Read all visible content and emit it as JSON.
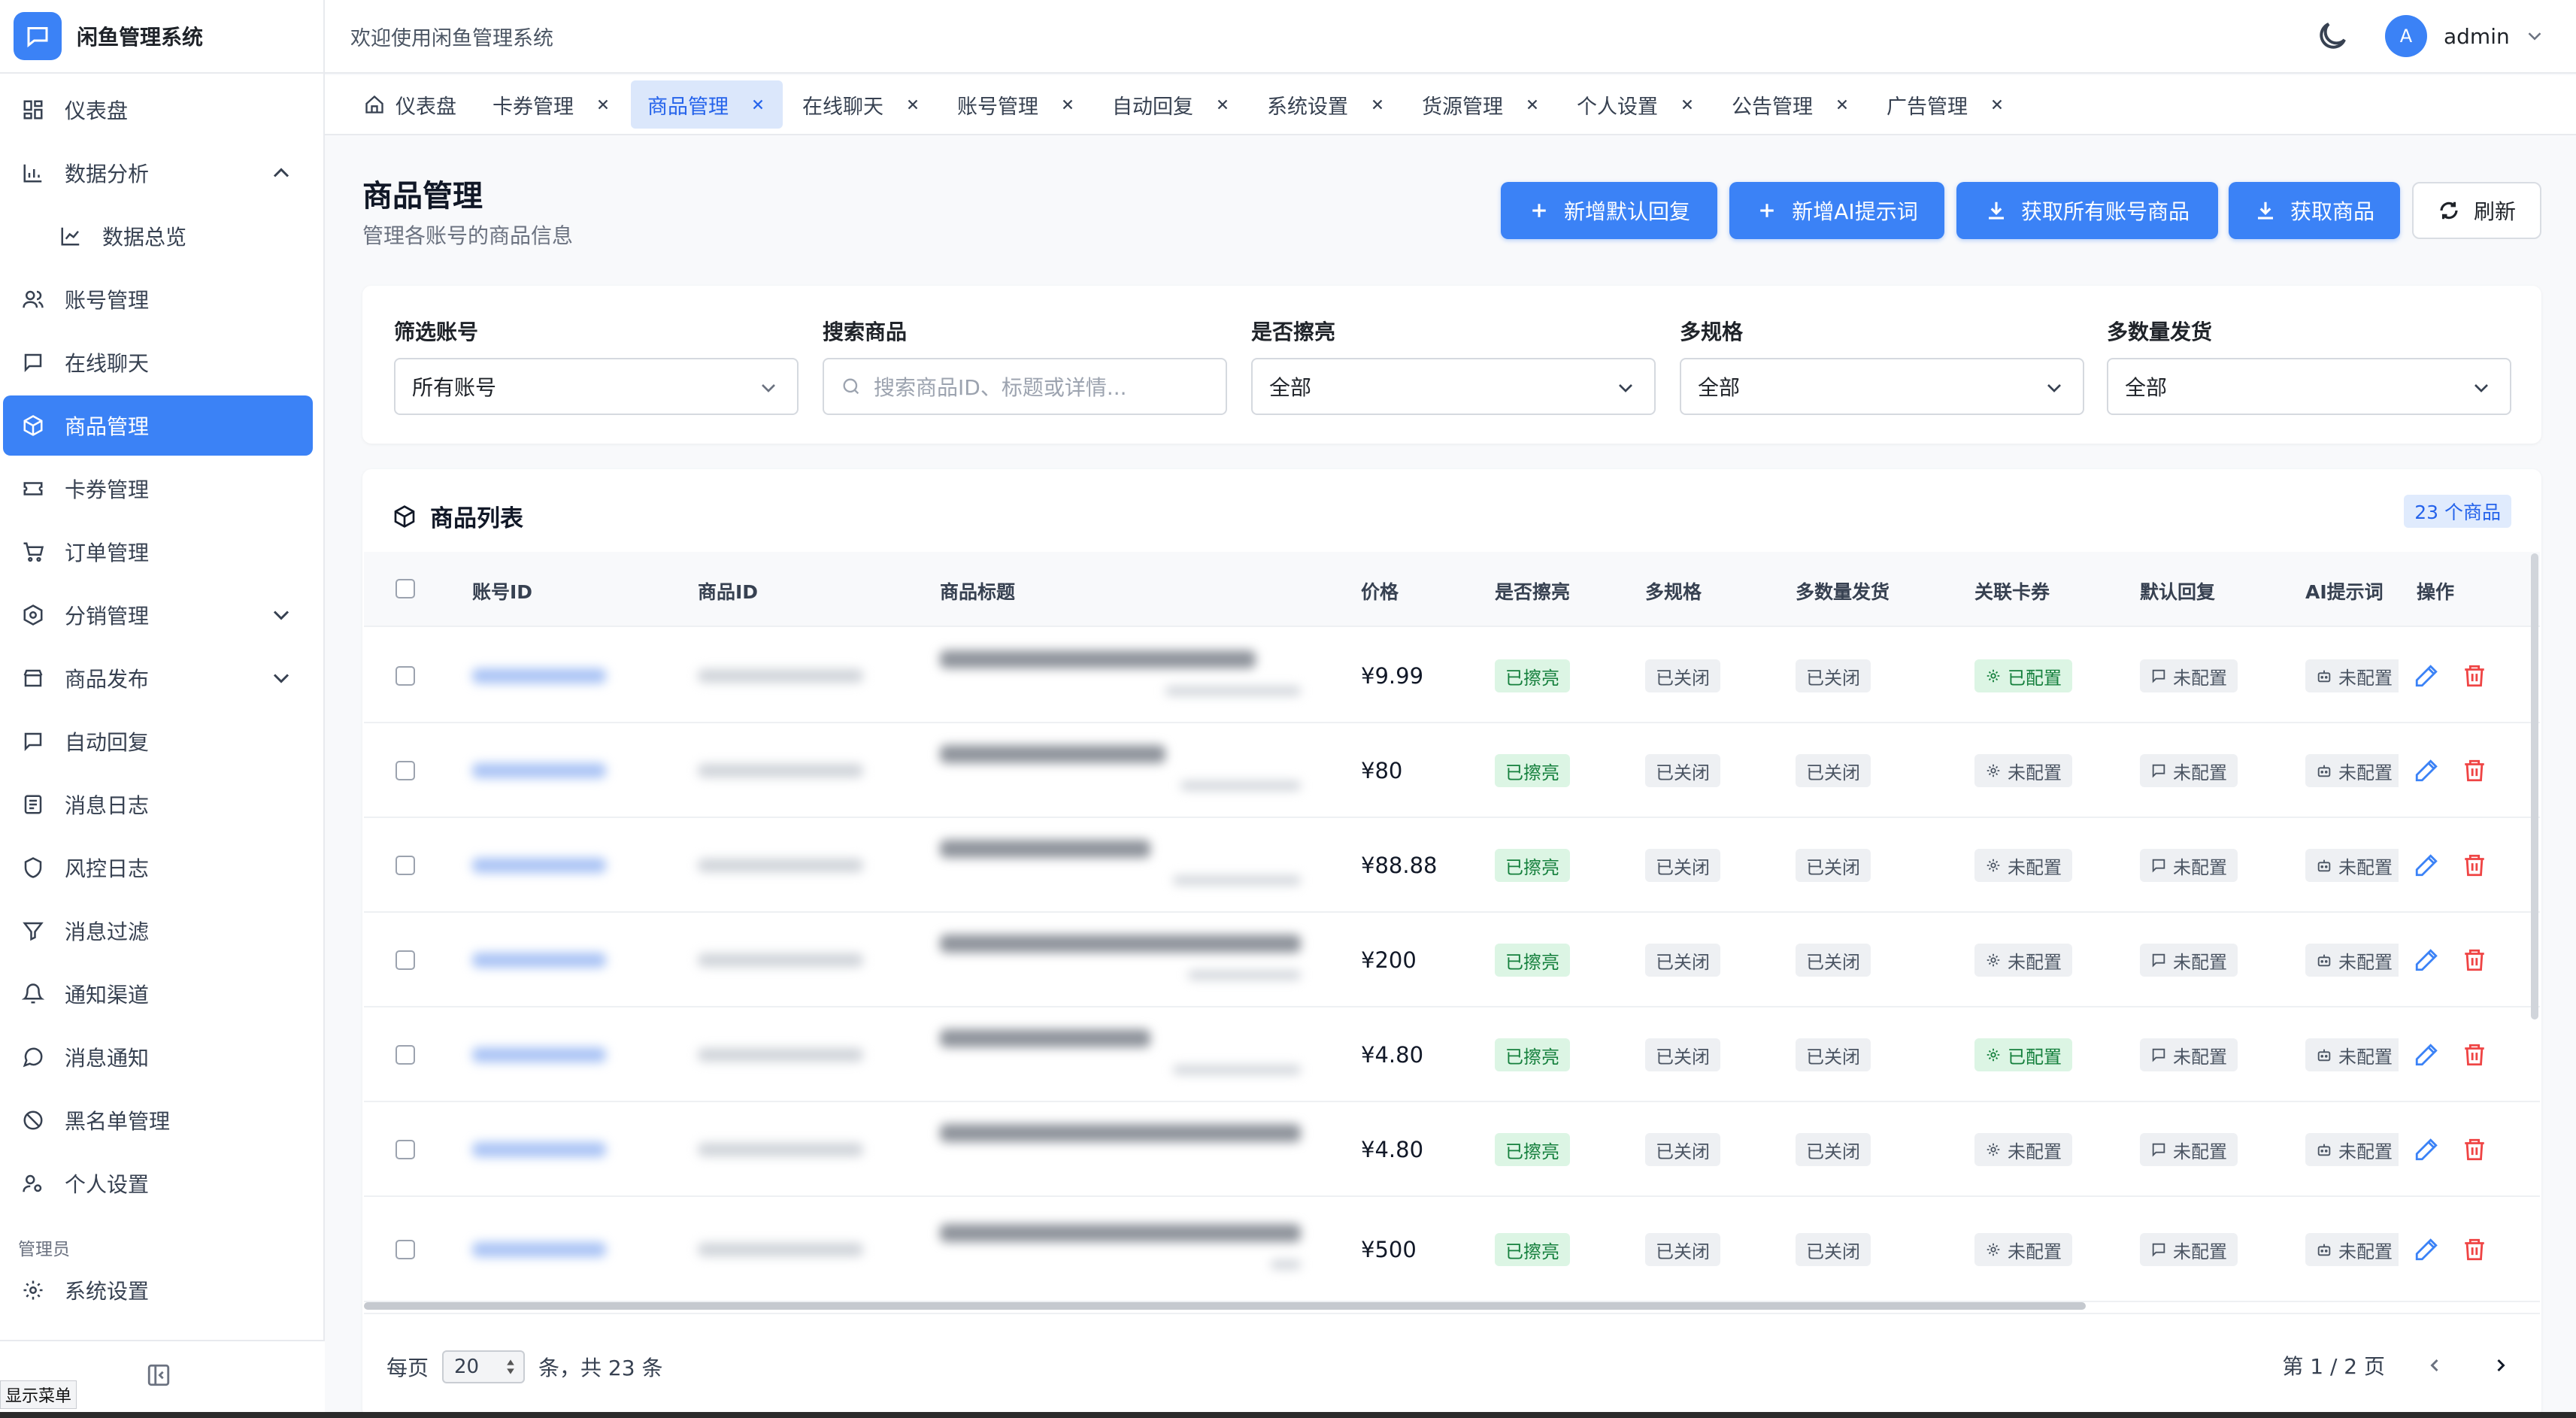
{
  "app": {
    "title": "闲鱼管理系统"
  },
  "topbar": {
    "welcome": "欢迎使用闲鱼管理系统",
    "user": {
      "avatar": "A",
      "name": "admin"
    }
  },
  "sidebar": {
    "items": [
      {
        "label": "仪表盘",
        "icon": "dashboard-icon"
      },
      {
        "label": "数据分析",
        "icon": "bar-chart-icon",
        "expanded": true
      },
      {
        "label": "数据总览",
        "icon": "line-chart-icon",
        "sub": true
      },
      {
        "label": "账号管理",
        "icon": "users-icon"
      },
      {
        "label": "在线聊天",
        "icon": "chat-icon"
      },
      {
        "label": "商品管理",
        "icon": "package-icon",
        "active": true
      },
      {
        "label": "卡券管理",
        "icon": "ticket-icon"
      },
      {
        "label": "订单管理",
        "icon": "cart-icon"
      },
      {
        "label": "分销管理",
        "icon": "distribution-icon",
        "collapsed": true
      },
      {
        "label": "商品发布",
        "icon": "store-icon",
        "collapsed": true
      },
      {
        "label": "自动回复",
        "icon": "message-icon"
      },
      {
        "label": "消息日志",
        "icon": "log-icon"
      },
      {
        "label": "风控日志",
        "icon": "shield-icon"
      },
      {
        "label": "消息过滤",
        "icon": "filter-icon"
      },
      {
        "label": "通知渠道",
        "icon": "bell-icon"
      },
      {
        "label": "消息通知",
        "icon": "notify-icon"
      },
      {
        "label": "黑名单管理",
        "icon": "ban-icon"
      },
      {
        "label": "个人设置",
        "icon": "user-settings-icon"
      }
    ],
    "section_admin": "管理员",
    "admin_item": "系统设置",
    "tooltip": "显示菜单"
  },
  "tabs": [
    {
      "label": "仪表盘",
      "home": true
    },
    {
      "label": "卡券管理",
      "closable": true
    },
    {
      "label": "商品管理",
      "closable": true,
      "active": true
    },
    {
      "label": "在线聊天",
      "closable": true
    },
    {
      "label": "账号管理",
      "closable": true
    },
    {
      "label": "自动回复",
      "closable": true
    },
    {
      "label": "系统设置",
      "closable": true
    },
    {
      "label": "货源管理",
      "closable": true
    },
    {
      "label": "个人设置",
      "closable": true
    },
    {
      "label": "公告管理",
      "closable": true
    },
    {
      "label": "广告管理",
      "closable": true
    }
  ],
  "page": {
    "title": "商品管理",
    "subtitle": "管理各账号的商品信息",
    "actions": {
      "add_default_reply": "新增默认回复",
      "add_ai_prompt": "新增AI提示词",
      "fetch_all": "获取所有账号商品",
      "fetch": "获取商品",
      "refresh": "刷新"
    }
  },
  "filters": {
    "account": {
      "label": "筛选账号",
      "value": "所有账号"
    },
    "search": {
      "label": "搜索商品",
      "placeholder": "搜索商品ID、标题或详情..."
    },
    "polished": {
      "label": "是否擦亮",
      "value": "全部"
    },
    "multi_spec": {
      "label": "多规格",
      "value": "全部"
    },
    "multi_qty": {
      "label": "多数量发货",
      "value": "全部"
    }
  },
  "table": {
    "title": "商品列表",
    "count_badge": "23 个商品",
    "columns": [
      "账号ID",
      "商品ID",
      "商品标题",
      "价格",
      "是否擦亮",
      "多规格",
      "多数量发货",
      "关联卡券",
      "默认回复",
      "AI提示词",
      "操作"
    ],
    "rows": [
      {
        "price": "¥9.99",
        "polished": "已擦亮",
        "multi_spec": "已关闭",
        "multi_qty": "已关闭",
        "card": "已配置",
        "card_on": true,
        "reply": "未配置",
        "ai": "未配置"
      },
      {
        "price": "¥80",
        "polished": "已擦亮",
        "multi_spec": "已关闭",
        "multi_qty": "已关闭",
        "card": "未配置",
        "card_on": false,
        "reply": "未配置",
        "ai": "未配置"
      },
      {
        "price": "¥88.88",
        "polished": "已擦亮",
        "multi_spec": "已关闭",
        "multi_qty": "已关闭",
        "card": "未配置",
        "card_on": false,
        "reply": "未配置",
        "ai": "未配置"
      },
      {
        "price": "¥200",
        "polished": "已擦亮",
        "multi_spec": "已关闭",
        "multi_qty": "已关闭",
        "card": "未配置",
        "card_on": false,
        "reply": "未配置",
        "ai": "未配置"
      },
      {
        "price": "¥4.80",
        "polished": "已擦亮",
        "multi_spec": "已关闭",
        "multi_qty": "已关闭",
        "card": "已配置",
        "card_on": true,
        "reply": "未配置",
        "ai": "未配置"
      },
      {
        "price": "¥4.80",
        "polished": "已擦亮",
        "multi_spec": "已关闭",
        "multi_qty": "已关闭",
        "card": "未配置",
        "card_on": false,
        "reply": "未配置",
        "ai": "未配置"
      },
      {
        "price": "¥500",
        "polished": "已擦亮",
        "multi_spec": "已关闭",
        "multi_qty": "已关闭",
        "card": "未配置",
        "card_on": false,
        "reply": "未配置",
        "ai": "未配置"
      }
    ]
  },
  "pagination": {
    "per_page_prefix": "每页",
    "per_page_value": "20",
    "per_page_suffix": "条，共 23 条",
    "page_info": "第 1 / 2 页"
  },
  "colors": {
    "accent": "#3b82f6",
    "success_bg": "#dcf5e4",
    "success_text": "#15803d",
    "danger": "#ef4444"
  }
}
